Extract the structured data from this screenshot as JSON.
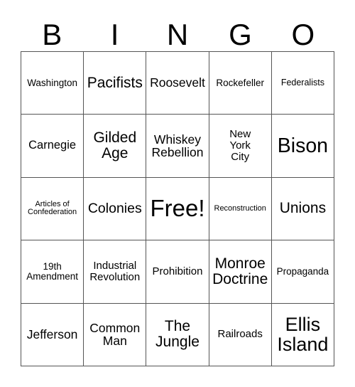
{
  "card": {
    "title_letters": [
      "B",
      "I",
      "N",
      "G",
      "O"
    ],
    "grid_size": "5x5",
    "border_color": "#555555",
    "text_color": "#000000",
    "background_color": "#ffffff",
    "rows": [
      [
        {
          "label": "Washington",
          "size": "fs-13"
        },
        {
          "label": "Pacifists",
          "size": "fs-21"
        },
        {
          "label": "Roosevelt",
          "size": "fs-17"
        },
        {
          "label": "Rockefeller",
          "size": "fs-13"
        },
        {
          "label": "Federalists",
          "size": "fs-12"
        }
      ],
      [
        {
          "label": "Carnegie",
          "size": "fs-16"
        },
        {
          "label": "Gilded\nAge",
          "size": "fs-21"
        },
        {
          "label": "Whiskey\nRebellion",
          "size": "fs-17"
        },
        {
          "label": "New\nYork\nCity",
          "size": "fs-15"
        },
        {
          "label": "Bison",
          "size": "fs-28"
        }
      ],
      [
        {
          "label": "Articles of\nConfederation",
          "size": "fs-11"
        },
        {
          "label": "Colonies",
          "size": "fs-19"
        },
        {
          "label": "Free!",
          "size": "fs-33"
        },
        {
          "label": "Reconstruction",
          "size": "fs-11"
        },
        {
          "label": "Unions",
          "size": "fs-21"
        }
      ],
      [
        {
          "label": "19th\nAmendment",
          "size": "fs-13"
        },
        {
          "label": "Industrial\nRevolution",
          "size": "fs-15"
        },
        {
          "label": "Prohibition",
          "size": "fs-15"
        },
        {
          "label": "Monroe\nDoctrine",
          "size": "fs-21"
        },
        {
          "label": "Propaganda",
          "size": "fs-13"
        }
      ],
      [
        {
          "label": "Jefferson",
          "size": "fs-17"
        },
        {
          "label": "Common\nMan",
          "size": "fs-17"
        },
        {
          "label": "The\nJungle",
          "size": "fs-21"
        },
        {
          "label": "Railroads",
          "size": "fs-15"
        },
        {
          "label": "Ellis\nIsland",
          "size": "fs-27"
        }
      ]
    ]
  }
}
